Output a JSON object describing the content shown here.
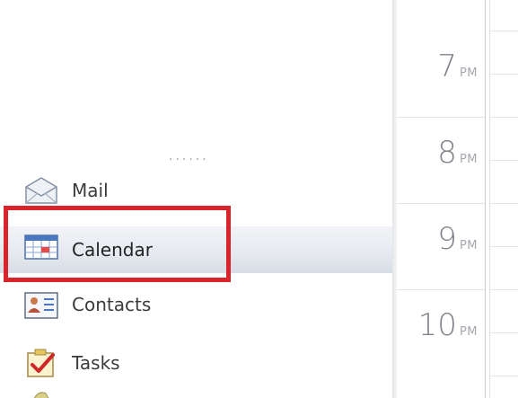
{
  "navigation": {
    "items": [
      {
        "id": "mail",
        "label": "Mail",
        "icon": "mail-icon"
      },
      {
        "id": "calendar",
        "label": "Calendar",
        "icon": "calendar-icon",
        "selected": true
      },
      {
        "id": "contacts",
        "label": "Contacts",
        "icon": "contacts-icon"
      },
      {
        "id": "tasks",
        "label": "Tasks",
        "icon": "tasks-icon"
      },
      {
        "id": "notes",
        "label": "",
        "icon": "notes-icon"
      }
    ],
    "highlight_color": "#d9242b"
  },
  "time_ruler": {
    "hours": [
      {
        "hour": "7",
        "period": "PM"
      },
      {
        "hour": "8",
        "period": "PM"
      },
      {
        "hour": "9",
        "period": "PM"
      },
      {
        "hour": "10",
        "period": "PM"
      }
    ]
  }
}
